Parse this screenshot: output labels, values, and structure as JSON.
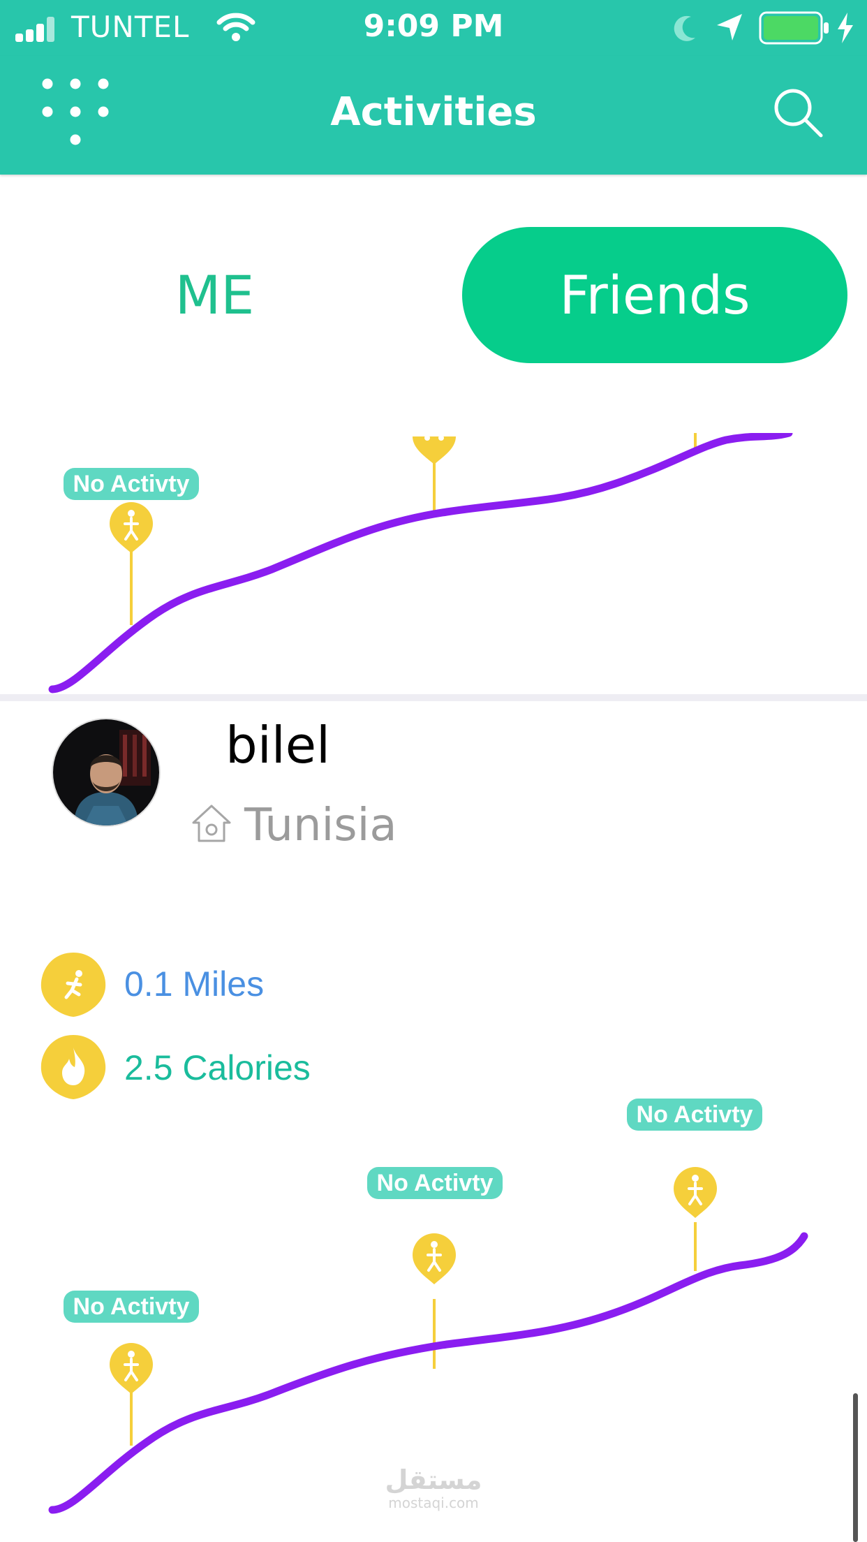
{
  "status_bar": {
    "carrier": "TUNTEL",
    "time": "9:09 PM"
  },
  "nav": {
    "title": "Activities",
    "menu_icon": "grid-dots-icon",
    "search_icon": "search-icon"
  },
  "segments": {
    "me": "ME",
    "friends": "Friends",
    "selected": "friends"
  },
  "no_activity_label": "No Activty",
  "friend": {
    "name": "bilel",
    "country": "Tunisia"
  },
  "stats": {
    "miles": "0.1 Miles",
    "calories": "2.5 Calories"
  },
  "watermark": {
    "arabic": "مستقل",
    "latin": "mostaqi.com"
  },
  "colors": {
    "primary": "#28c6ab",
    "segment_active": "#06cd8b",
    "curve": "#8a1df0",
    "marker": "#f5cf3b",
    "tag": "#5fd8c2"
  }
}
